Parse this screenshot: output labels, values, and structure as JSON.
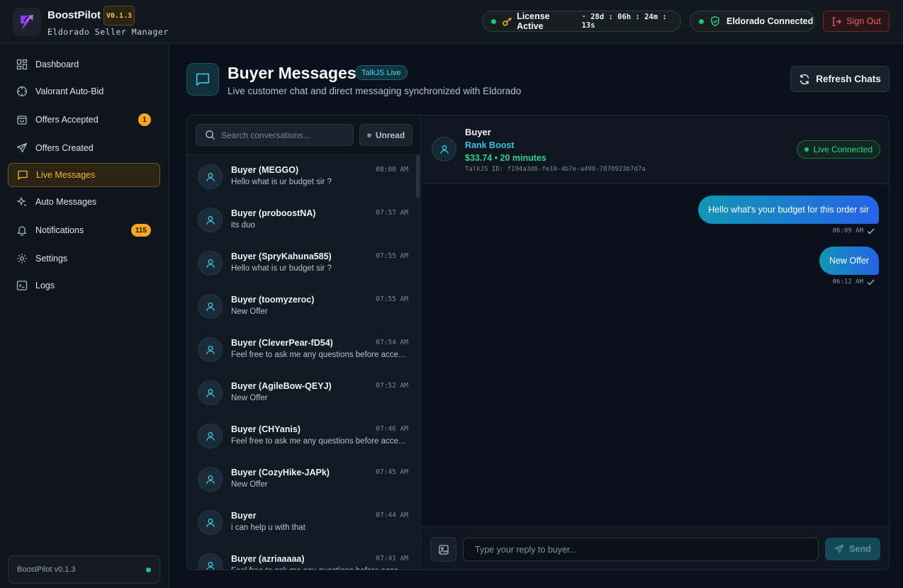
{
  "app": {
    "name": "BoostPilot",
    "version_chip": "V0.1.3",
    "subtitle": "Eldorado Seller Manager"
  },
  "topbar": {
    "license_label": "License Active",
    "license_timer": "· 28d : 06h : 24m : 13s",
    "eldorado_label": "Eldorado Connected",
    "signout_label": "Sign Out"
  },
  "sidebar": {
    "items": [
      {
        "label": "Dashboard",
        "icon": "dashboard-icon"
      },
      {
        "label": "Valorant Auto-Bid",
        "icon": "crosshair-icon"
      },
      {
        "label": "Offers Accepted",
        "icon": "bag-icon",
        "badge": "1"
      },
      {
        "label": "Offers Created",
        "icon": "send-icon"
      },
      {
        "label": "Live Messages",
        "icon": "chat-icon",
        "active": true
      },
      {
        "label": "Auto Messages",
        "icon": "sparkles-icon"
      },
      {
        "label": "Notifications",
        "icon": "bell-icon",
        "badge": "115"
      },
      {
        "label": "Settings",
        "icon": "gear-icon"
      },
      {
        "label": "Logs",
        "icon": "terminal-icon"
      }
    ],
    "footer": "BoostPilot v0.1.3"
  },
  "header": {
    "title": "Buyer Messages",
    "badge": "TalkJS Live",
    "subtitle": "Live customer chat and direct messaging synchronized with Eldorado",
    "refresh_label": "Refresh Chats"
  },
  "list": {
    "search_placeholder": "Search conversations...",
    "unread_label": "Unread",
    "conversations": [
      {
        "name": "Buyer (MEGGO)",
        "preview": "Hello what is ur budget sir ?",
        "time": "08:00 AM"
      },
      {
        "name": "Buyer (proboostNA)",
        "preview": "its duo",
        "time": "07:57 AM"
      },
      {
        "name": "Buyer (SpryKahuna585)",
        "preview": "Hello what is ur budget sir ?",
        "time": "07:55 AM"
      },
      {
        "name": "Buyer (toomyzeroc)",
        "preview": "New Offer",
        "time": "07:55 AM"
      },
      {
        "name": "Buyer (CleverPear-fD54)",
        "preview": "Feel free to ask me any questions before acceptin...",
        "time": "07:54 AM"
      },
      {
        "name": "Buyer (AgileBow-QEYJ)",
        "preview": "New Offer",
        "time": "07:52 AM"
      },
      {
        "name": "Buyer (CHYanis)",
        "preview": "Feel free to ask me any questions before acceptin...",
        "time": "07:46 AM"
      },
      {
        "name": "Buyer (CozyHike-JAPk)",
        "preview": "New Offer",
        "time": "07:45 AM"
      },
      {
        "name": "Buyer",
        "preview": "i can help u with that",
        "time": "07:44 AM"
      },
      {
        "name": "Buyer (azriaaaaa)",
        "preview": "Feel free to ask me any questions before acceptin...",
        "time": "07:41 AM"
      }
    ]
  },
  "chat": {
    "name": "Buyer",
    "service": "Rank Boost",
    "price": "$33.74 • 20 minutes",
    "talkjs_id": "TalkJS ID: f194a3d6-fe10-4b7e-a498-7878923b7d7a",
    "status": "Live Connected",
    "messages": [
      {
        "text": "Hello what's your budget for this order sir",
        "time": "06:09 AM"
      },
      {
        "text": "New Offer",
        "time": "06:12 AM"
      }
    ],
    "reply_placeholder": "Type your reply to buyer...",
    "send_label": "Send"
  }
}
